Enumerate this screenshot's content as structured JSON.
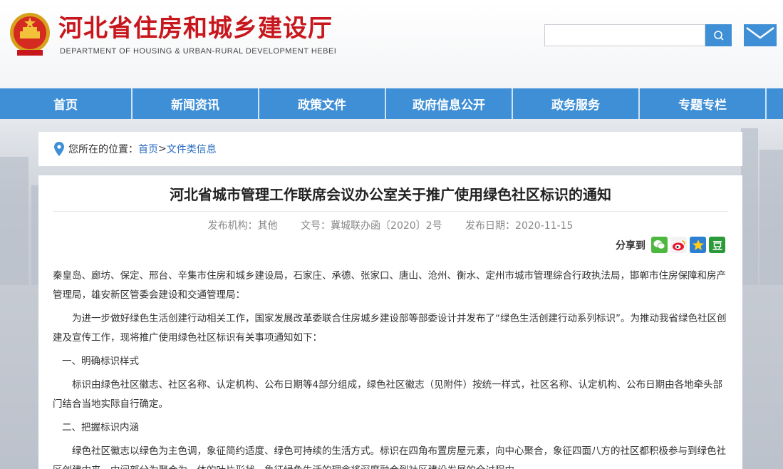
{
  "site": {
    "title": "河北省住房和城乡建设厅",
    "subtitle": "DEPARTMENT OF HOUSING & URBAN-RURAL DEVELOPMENT HEBEI"
  },
  "search": {
    "placeholder": ""
  },
  "nav": {
    "items": [
      {
        "label": "首页"
      },
      {
        "label": "新闻资讯"
      },
      {
        "label": "政策文件"
      },
      {
        "label": "政府信息公开"
      },
      {
        "label": "政务服务"
      },
      {
        "label": "专题专栏"
      }
    ]
  },
  "breadcrumb": {
    "label": "您所在的位置：",
    "home": "首页",
    "sep": ">",
    "current": "文件类信息"
  },
  "article": {
    "title": "河北省城市管理工作联席会议办公室关于推广使用绿色社区标识的通知",
    "publisher": "发布机构：其他",
    "doc_no": "文号：冀城联办函〔2020〕2号",
    "date": "发布日期：2020-11-15",
    "share_label": "分享到",
    "paragraphs": [
      "秦皇岛、廊坊、保定、邢台、辛集市住房和城乡建设局，石家庄、承德、张家口、唐山、沧州、衡水、定州市城市管理综合行政执法局，邯郸市住房保障和房产管理局，雄安新区管委会建设和交通管理局：",
      "为进一步做好绿色生活创建行动相关工作，国家发展改革委联合住房城乡建设部等部委设计并发布了“绿色生活创建行动系列标识”。为推动我省绿色社区创建及宣传工作，现将推广使用绿色社区标识有关事项通知如下：",
      "一、明确标识样式",
      "标识由绿色社区徽志、社区名称、认定机构、公布日期等4部分组成，绿色社区徽志（见附件）按统一样式，社区名称、认定机构、公布日期由各地牵头部门结合当地实际自行确定。",
      "二、把握标识内涵",
      "绿色社区徽志以绿色为主色调，象征简约适度、绿色可持续的生活方式。标识在四角布置房屋元素，向中心聚合，象征四面八方的社区都积极参与到绿色社区创建中来。中间部分为聚合为一体的叶片形状，象征绿色生活的理念将深度融合到社区建设发展的全过程中。"
    ]
  },
  "colors": {
    "brand_red": "#c8161d",
    "nav_blue": "#3f8fd6",
    "link_blue": "#2a6cc4"
  }
}
